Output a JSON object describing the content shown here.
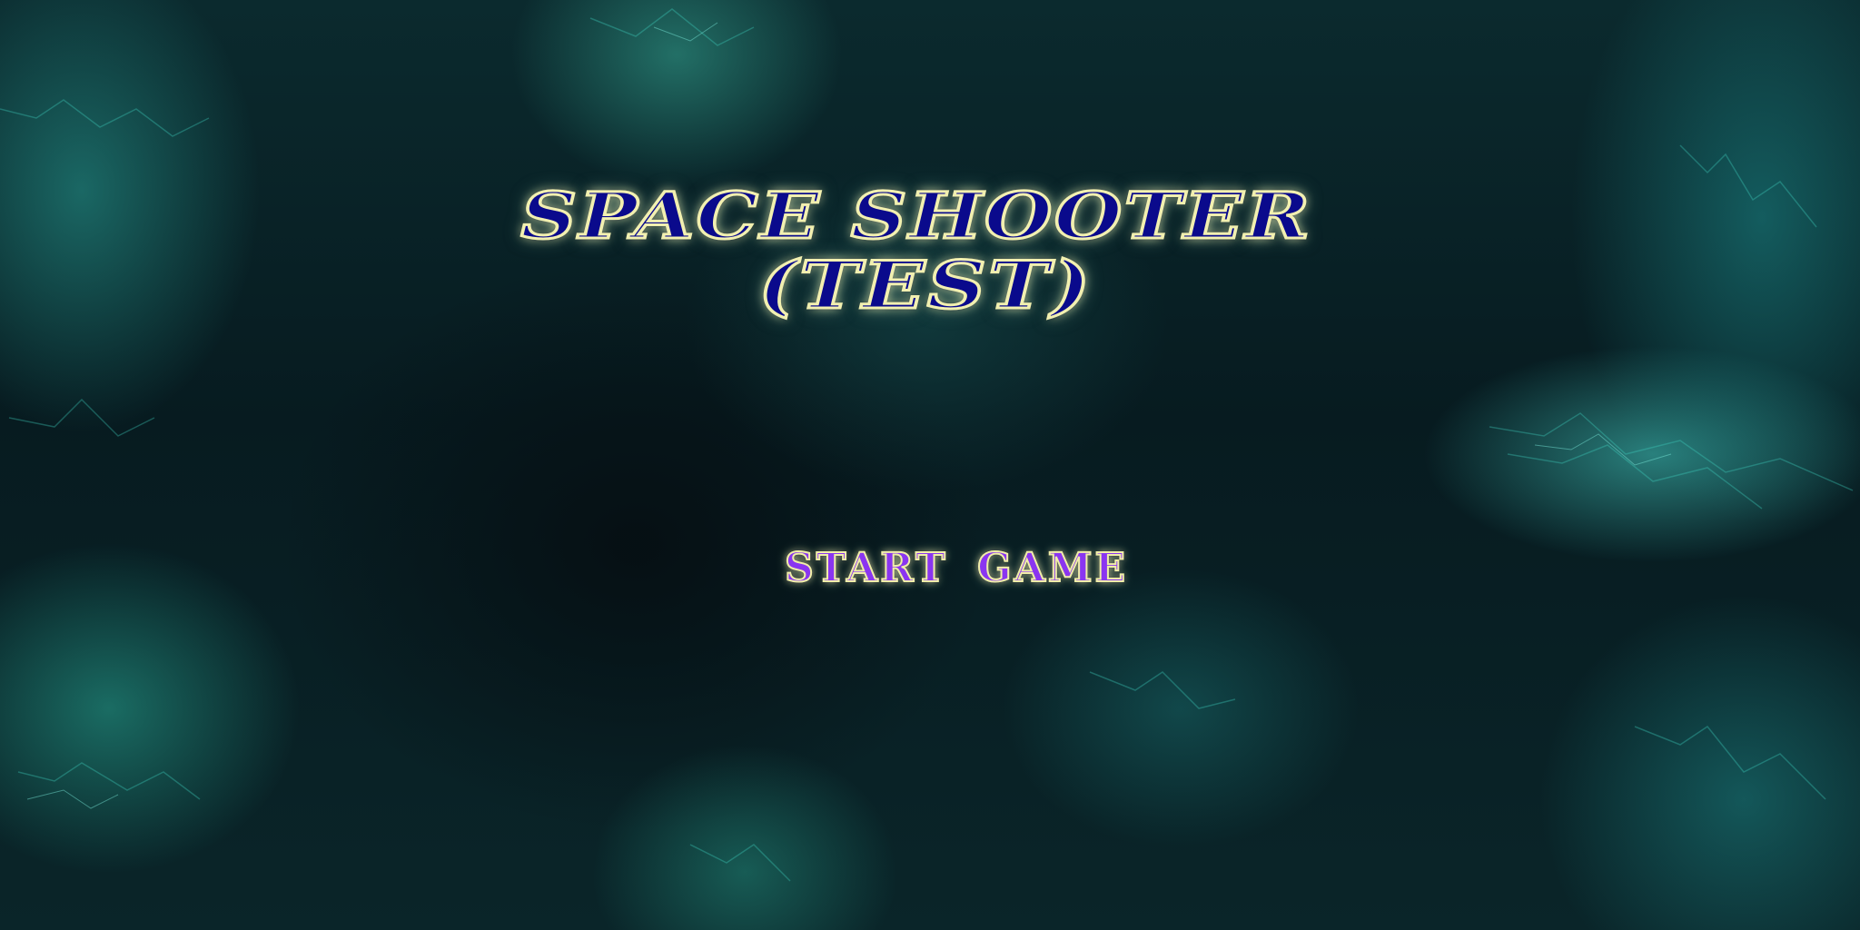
{
  "title": {
    "line1": "SPACE SHOOTER",
    "line2": "(TEST)"
  },
  "menu": {
    "start_label": "START GAME"
  },
  "colors": {
    "title_fill": "#0a0a8c",
    "title_outline": "#f2f0b0",
    "button_fill": "#8a35f0",
    "background": "#071b20"
  }
}
